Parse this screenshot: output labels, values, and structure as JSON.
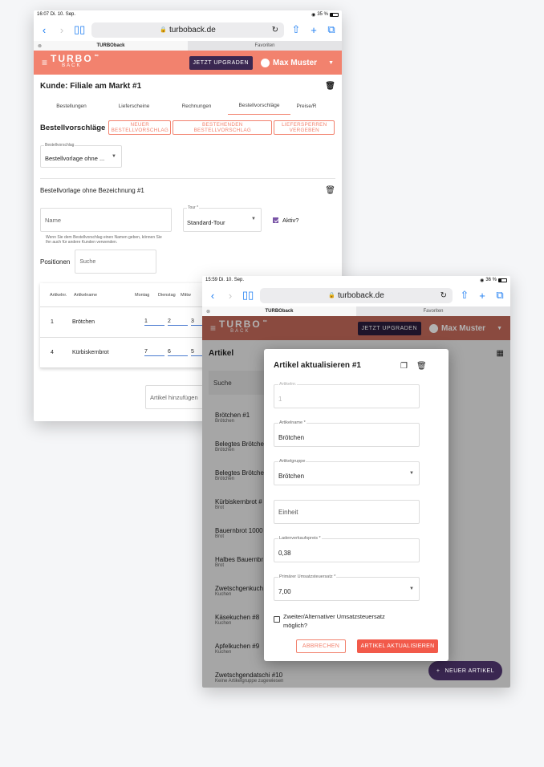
{
  "back": {
    "status": {
      "time": "16:07",
      "date": "Di. 10. Sep.",
      "battery": "35 %"
    },
    "browser": {
      "url": "turboback.de",
      "tabs": [
        "TURBOback",
        "Favoriten"
      ]
    },
    "appbar": {
      "logo_main": "TURBO",
      "logo_sub": "BACK",
      "upgrade": "JETZT UPGRADEN",
      "user": "Max Muster"
    },
    "title": "Kunde: Filiale am Markt #1",
    "subnav": [
      "Bestellungen",
      "Lieferscheine",
      "Rechnungen",
      "Bestellvorschläge",
      "Preise/R"
    ],
    "bv": {
      "title": "Bestellvorschläge",
      "btn_new": "NEUER BESTELLVORSCHLAG",
      "btn_existing": "BESTEHENDEN BESTELLVORSCHLAG",
      "btn_block": "LIEFERSPERREN VERGEBEN"
    },
    "select_label": "Bestellvorschlag",
    "select_value": "Bestellvorlage ohne ...",
    "section_title": "Bestellvorlage ohne Bezeichnung #1",
    "name_placeholder": "Name",
    "tour_label": "Tour *",
    "tour_value": "Standard-Tour",
    "aktiv_label": "Aktiv?",
    "hint": "Wenn Sie dem Bestellvorschlag einen Namen geben, können Sie Ihn auch für andere Kunden verwenden.",
    "positionen": "Positionen",
    "search_placeholder": "Suche",
    "table": {
      "headers": [
        "Artikelnr.",
        "Artikelname",
        "Montag",
        "Dienstag",
        "Mittw"
      ],
      "rows": [
        {
          "nr": "1",
          "name": "Brötchen",
          "mo": "1",
          "di": "2",
          "mi": "3"
        },
        {
          "nr": "4",
          "name": "Kürbiskernbrot",
          "mo": "7",
          "di": "6",
          "mi": "5"
        }
      ]
    },
    "add_article": "Artikel hinzufügen"
  },
  "front": {
    "status": {
      "time": "15:59",
      "date": "Di. 10. Sep.",
      "battery": "36 %"
    },
    "browser": {
      "url": "turboback.de",
      "tabs": [
        "TURBOback",
        "Favoriten"
      ]
    },
    "appbar": {
      "logo_main": "TURBO",
      "logo_sub": "BACK",
      "upgrade": "JETZT UPGRADEN",
      "user": "Max Muster"
    },
    "title": "Artikel",
    "search_placeholder": "Suche",
    "list": [
      {
        "title": "Brötchen #1",
        "sub": "Brötchen"
      },
      {
        "title": "Belegtes Brötche",
        "sub": "Brötchen"
      },
      {
        "title": "Belegtes Brötche",
        "sub": "Brötchen"
      },
      {
        "title": "Kürbiskernbrot #",
        "sub": "Brot"
      },
      {
        "title": "Bauernbrot 1000",
        "sub": "Brot"
      },
      {
        "title": "Halbes Bauernbr",
        "sub": "Brot"
      },
      {
        "title": "Zwetschgenkuch",
        "sub": "Kuchen"
      },
      {
        "title": "Käsekuchen #8",
        "sub": "Kuchen"
      },
      {
        "title": "Apfelkuchen #9",
        "sub": "Kuchen"
      },
      {
        "title": "Zwetschgendatschi #10",
        "sub": "Keine Artikelgruppe zugewiesen"
      }
    ],
    "fab": "NEUER ARTIKEL",
    "dialog": {
      "title": "Artikel aktualisieren #1",
      "artikelnr_label": "Artikelnr.",
      "artikelnr_value": "1",
      "name_label": "Artikelname *",
      "name_value": "Brötchen",
      "group_label": "Artikelgruppe",
      "group_value": "Brötchen",
      "unit_placeholder": "Einheit",
      "price_label": "Ladenverkaufspreis *",
      "price_value": "0,38",
      "tax_label": "Primärer Umsatzsteuersatz *",
      "tax_value": "7,00",
      "alt_tax_label": "Zweiter/Alternativer Umsatzsteuersatz möglich?",
      "cancel": "ABBRECHEN",
      "submit": "ARTIKEL AKTUALISIEREN"
    }
  },
  "colors": {
    "brand": "#f2826e",
    "purple": "#3a2751",
    "link": "#1b7cf2"
  }
}
